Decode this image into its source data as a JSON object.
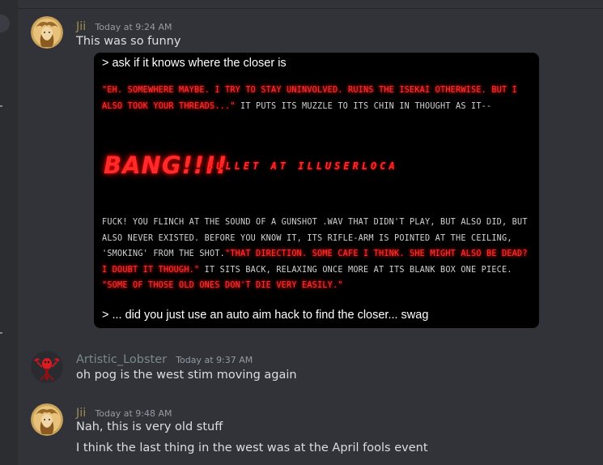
{
  "messages": [
    {
      "author": "Jii",
      "author_color": "#9b8a4f",
      "timestamp": "Today at 9:24 AM",
      "lines": [
        "This was so funny"
      ],
      "embed": {
        "prompt_top": "> ask if it knows where the closer is",
        "para1_red": "\"EH. SOMEWHERE MAYBE. I TRY TO STAY UNINVOLVED. RUINS THE ISEKAI OTHERWISE. BUT I ALSO TOOK YOUR THREADS...\"",
        "para1_white": " IT PUTS ITS MUZZLE TO ITS CHIN IN THOUGHT AS IT--",
        "bang": "BANG!!!!",
        "bang_garble": "BULLET AT ILLUSERLOCA",
        "para2_white1": "FUCK! YOU FLINCH AT THE SOUND OF A GUNSHOT .WAV THAT DIDN'T PLAY, BUT ALSO DID, BUT ALSO NEVER EXISTED. BEFORE YOU KNOW IT, ITS RIFLE-ARM IS POINTED AT THE CEILING, 'SMOKING' FROM THE SHOT.",
        "para2_red1": "\"THAT DIRECTION. SOME CAFE I THINK. SHE MIGHT ALSO BE DEAD? I DOUBT IT THOUGH.\"",
        "para2_white2": " IT SITS BACK, RELAXING ONCE MORE AT ITS BLANK BOX ONE PIECE. ",
        "para2_red2": "\"SOME OF THOSE OLD ONES DON'T DIE VERY EASILY.\"",
        "prompt_bottom": "> ... did you just use an auto aim hack to find the closer... swag"
      }
    },
    {
      "author": "Artistic_Lobster",
      "author_color": "#7a8a86",
      "timestamp": "Today at 9:37 AM",
      "lines": [
        "oh pog is the west stim moving again"
      ]
    },
    {
      "author": "Jii",
      "author_color": "#9b8a4f",
      "timestamp": "Today at 9:48 AM",
      "lines": [
        "Nah, this is very old stuff",
        "I think the last thing in the west was at the April fools event"
      ]
    }
  ]
}
